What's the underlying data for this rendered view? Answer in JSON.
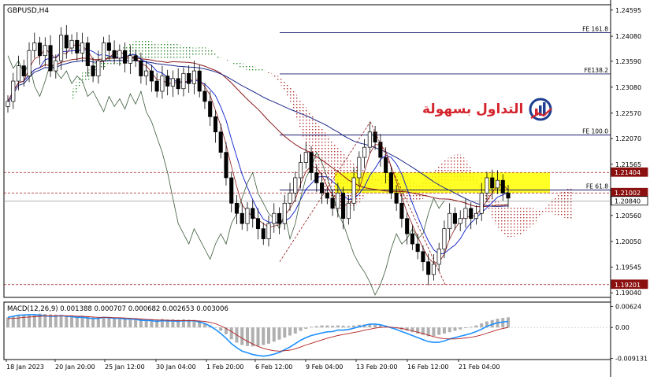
{
  "chart_data": {
    "type": "candlestick",
    "symbol_label": "GBPUSD,H4",
    "ylim": [
      1.1895,
      1.247
    ],
    "y_ticks": [
      "1.24595",
      "1.24080",
      "1.23590",
      "1.23080",
      "1.22570",
      "1.22070",
      "1.21565",
      "1.21050",
      "1.20560",
      "1.20050",
      "1.19545",
      "1.19040"
    ],
    "x_ticks": [
      "18 Jan 2023",
      "20 Jan 20:00",
      "25 Jan 12:00",
      "30 Jan 04:00",
      "1 Feb 20:00",
      "6 Feb 12:00",
      "9 Feb 04:00",
      "13 Feb 20:00",
      "16 Feb 12:00",
      "21 Feb 04:00"
    ],
    "price_badges": [
      {
        "value": 1.21404,
        "label": "1.21404",
        "kind": "red-level"
      },
      {
        "value": 1.21002,
        "label": "1.21002",
        "kind": "red-level"
      },
      {
        "value": 1.2084,
        "label": "1.20840",
        "kind": "current"
      },
      {
        "value": 1.19201,
        "label": "1.19201",
        "kind": "red-level"
      }
    ],
    "fib_levels": [
      {
        "label": "FE 161.8",
        "value": 1.2415
      },
      {
        "label": "FE138.2",
        "value": 1.2334
      },
      {
        "label": "FE 100.0",
        "value": 1.2214
      },
      {
        "label": "FE 61.8",
        "value": 1.2106
      }
    ],
    "closes": [
      1.228,
      1.232,
      1.235,
      1.233,
      1.238,
      1.2395,
      1.237,
      1.239,
      1.234,
      1.236,
      1.241,
      1.2385,
      1.24,
      1.2375,
      1.2395,
      1.235,
      1.233,
      1.236,
      1.2395,
      1.238,
      1.2365,
      1.238,
      1.2355,
      1.237,
      1.236,
      1.233,
      1.234,
      1.232,
      1.23,
      1.233,
      1.231,
      1.2325,
      1.2305,
      1.2335,
      1.2315,
      1.234,
      1.23,
      1.228,
      1.225,
      1.222,
      1.218,
      1.213,
      1.208,
      1.206,
      1.204,
      1.207,
      1.205,
      1.203,
      1.201,
      1.204,
      1.206,
      1.204,
      1.208,
      1.21,
      1.213,
      1.216,
      1.218,
      1.214,
      1.212,
      1.21,
      1.209,
      1.207,
      1.21,
      1.205,
      1.208,
      1.213,
      1.217,
      1.219,
      1.222,
      1.22,
      1.217,
      1.214,
      1.21,
      1.208,
      1.205,
      1.202,
      1.2,
      1.1985,
      1.1965,
      1.194,
      1.196,
      1.199,
      1.203,
      1.206,
      1.204,
      1.205,
      1.207,
      1.205,
      1.206,
      1.21,
      1.213,
      1.211,
      1.2125,
      1.21,
      1.209
    ],
    "macd": {
      "label": "MACD(12,26,9) 0.001388 0.000707 0.000682 0.002653 0.003006",
      "ylim": [
        -0.0095,
        0.0075
      ],
      "y_ticks": [
        "0.00624",
        "0.00",
        "-0.009131"
      ],
      "histogram": [
        0.003,
        0.0032,
        0.0035,
        0.0036,
        0.0038,
        0.004,
        0.0041,
        0.004,
        0.0039,
        0.0038,
        0.0037,
        0.0036,
        0.0036,
        0.0034,
        0.0033,
        0.0031,
        0.003,
        0.0029,
        0.003,
        0.0031,
        0.003,
        0.0029,
        0.0028,
        0.0027,
        0.0026,
        0.0026,
        0.0025,
        0.0025,
        0.0024,
        0.0025,
        0.0024,
        0.0024,
        0.0023,
        0.0024,
        0.0023,
        0.0022,
        0.0018,
        0.0012,
        0.0006,
        0.0,
        -0.001,
        -0.002,
        -0.0035,
        -0.0045,
        -0.0052,
        -0.0055,
        -0.0056,
        -0.0055,
        -0.0052,
        -0.0048,
        -0.0042,
        -0.0036,
        -0.003,
        -0.0024,
        -0.0018,
        -0.001,
        -0.0004,
        0.0002,
        0.0004,
        0.0006,
        0.0006,
        0.0005,
        0.0006,
        0.0005,
        0.0004,
        0.0006,
        0.0008,
        0.0009,
        0.001,
        0.0008,
        0.0006,
        0.0003,
        0.0,
        -0.0003,
        -0.0006,
        -0.001,
        -0.0014,
        -0.0018,
        -0.0022,
        -0.0026,
        -0.0025,
        -0.0022,
        -0.0018,
        -0.0014,
        -0.001,
        -0.0006,
        -0.0002,
        0.0002,
        0.0006,
        0.0012,
        0.0018,
        0.0022,
        0.0026,
        0.0028,
        0.003
      ],
      "macd_line": [
        0.003,
        0.0033,
        0.0036,
        0.0037,
        0.0038,
        0.0038,
        0.0036,
        0.0034,
        0.0033,
        0.0033,
        0.0035,
        0.0033,
        0.0032,
        0.003,
        0.003,
        0.0028,
        0.0026,
        0.0027,
        0.003,
        0.0029,
        0.0027,
        0.0027,
        0.0025,
        0.0025,
        0.0024,
        0.0021,
        0.0021,
        0.002,
        0.0018,
        0.002,
        0.0019,
        0.0019,
        0.0018,
        0.002,
        0.0019,
        0.002,
        0.0016,
        0.0012,
        0.0004,
        -0.0006,
        -0.0018,
        -0.0032,
        -0.0048,
        -0.006,
        -0.007,
        -0.0075,
        -0.008,
        -0.0083,
        -0.0085,
        -0.0083,
        -0.0079,
        -0.0074,
        -0.0066,
        -0.0058,
        -0.0048,
        -0.0038,
        -0.003,
        -0.0024,
        -0.002,
        -0.0016,
        -0.0013,
        -0.0012,
        -0.0008,
        -0.0008,
        -0.0006,
        -0.0002,
        0.0002,
        0.0006,
        0.001,
        0.001,
        0.0008,
        0.0004,
        -0.0001,
        -0.0006,
        -0.0012,
        -0.0018,
        -0.0024,
        -0.003,
        -0.0036,
        -0.0042,
        -0.0044,
        -0.0044,
        -0.004,
        -0.0034,
        -0.003,
        -0.0026,
        -0.0022,
        -0.0018,
        -0.0012,
        -0.0005,
        0.0003,
        0.0009,
        0.0014,
        0.0016,
        0.0018
      ],
      "signal_line": [
        0.0026,
        0.0027,
        0.0028,
        0.003,
        0.0031,
        0.0032,
        0.0033,
        0.0034,
        0.0034,
        0.0034,
        0.0034,
        0.0034,
        0.0034,
        0.0033,
        0.0033,
        0.0032,
        0.0031,
        0.003,
        0.003,
        0.003,
        0.0029,
        0.0029,
        0.0028,
        0.0027,
        0.0026,
        0.0025,
        0.0024,
        0.0023,
        0.0022,
        0.0022,
        0.0021,
        0.0021,
        0.002,
        0.002,
        0.002,
        0.002,
        0.0019,
        0.0018,
        0.0015,
        0.0011,
        0.0005,
        -0.0003,
        -0.0012,
        -0.0022,
        -0.0032,
        -0.0041,
        -0.0049,
        -0.0056,
        -0.0062,
        -0.0066,
        -0.0069,
        -0.007,
        -0.0069,
        -0.0067,
        -0.0063,
        -0.0058,
        -0.0052,
        -0.0047,
        -0.0042,
        -0.0037,
        -0.0032,
        -0.0028,
        -0.0024,
        -0.0021,
        -0.0018,
        -0.0015,
        -0.0012,
        -0.0008,
        -0.0005,
        -0.0002,
        0.0,
        0.0001,
        0.0001,
        -0.0001,
        -0.0003,
        -0.0006,
        -0.001,
        -0.0014,
        -0.0018,
        -0.0023,
        -0.0027,
        -0.0031,
        -0.0033,
        -0.0034,
        -0.0034,
        -0.0033,
        -0.0031,
        -0.0029,
        -0.0026,
        -0.0022,
        -0.0017,
        -0.0012,
        -0.0007,
        -0.0003,
        0.0
      ]
    }
  },
  "branding": {
    "logo_text": "التداول بسهولة",
    "brand_red": "#d4252e",
    "brand_blue": "#1d3f8f",
    "logo_icon": "rising-bars-chart-icon"
  },
  "colors": {
    "bull_candle": "#ffffff",
    "bear_candle": "#000000",
    "ma_blue": "#0b1ec8",
    "ma_maroon": "#8b1a1a",
    "ichimoku_green": "#2f8a2f",
    "ichimoku_red": "#b03030",
    "highlight_zone": "#ffff00",
    "macd_line": "#1e90ff",
    "signal_line": "#b22222",
    "macd_hist": "#b0b0b0"
  }
}
